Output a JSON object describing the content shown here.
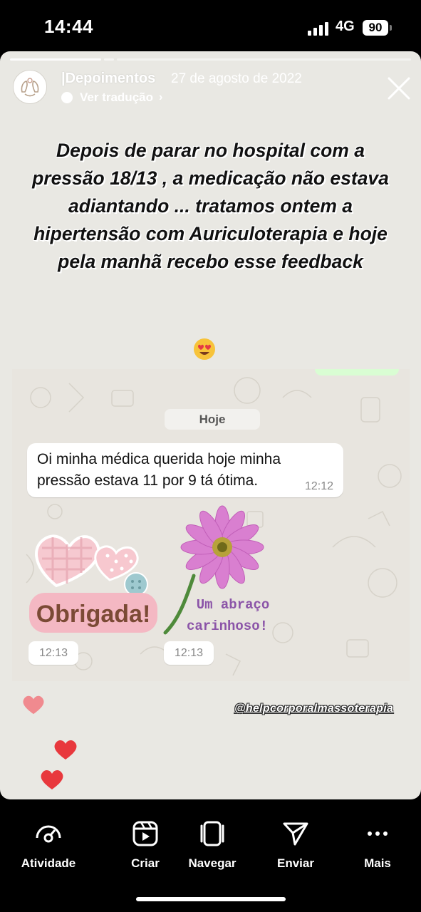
{
  "status_bar": {
    "time": "14:44",
    "network": "4G",
    "battery": "90"
  },
  "story": {
    "username": "|Depoimentos",
    "date": "27 de agosto de 2022",
    "translate_label": "Ver tradução",
    "caption": "Depois de parar no hospital com a pressão 18/13 , a medicação não estava adiantando ... tratamos ontem a hipertensão com Auriculoterapia e hoje pela manhã recebo esse feedback",
    "watermark": "@helpcorporalmassoterapia"
  },
  "chat": {
    "date_pill": "Hoje",
    "message": {
      "text": "Oi minha médica querida hoje minha pressão estava 11 por 9 tá ótima.",
      "time": "12:12"
    },
    "stickers": [
      {
        "text": "Obrigada!",
        "time": "12:13",
        "icon": "hearts-sticker"
      },
      {
        "text_line1": "Um abraço",
        "text_line2": "carinhoso!",
        "time": "12:13",
        "icon": "flower-sticker"
      }
    ]
  },
  "bottom_nav": [
    {
      "label": "Atividade",
      "icon": "activity-icon"
    },
    {
      "label": "Criar",
      "icon": "reels-icon"
    },
    {
      "label": "Navegar",
      "icon": "browse-icon"
    },
    {
      "label": "Enviar",
      "icon": "send-icon"
    },
    {
      "label": "Mais",
      "icon": "more-icon"
    }
  ],
  "colors": {
    "story_bg": "#e9e8e3",
    "chat_bg": "#e8e5df",
    "heart_red": "#e8383d",
    "heart_pink": "#f08a8f"
  }
}
